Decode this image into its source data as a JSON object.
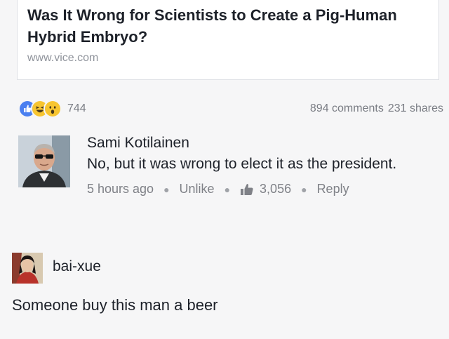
{
  "link_preview": {
    "title": "Was It Wrong for Scientists to Create a Pig-Human Hybrid Embryo?",
    "domain": "www.vice.com"
  },
  "reactions": {
    "icons": [
      "like-icon",
      "haha-icon",
      "wow-icon"
    ],
    "count": "744",
    "comments": "894 comments",
    "shares": "231 shares"
  },
  "comment": {
    "author": "Sami Kotilainen",
    "text": "No, but it was wrong to elect it as the president.",
    "time": "5 hours ago",
    "unlike_label": "Unlike",
    "like_count": "3,056",
    "reply_label": "Reply"
  },
  "reply": {
    "author": "bai-xue",
    "text": "Someone buy this man a beer"
  },
  "colors": {
    "like_blue": "#4a7ff0",
    "emoji_yellow": "#f7c531",
    "text_dark": "#1d2129",
    "text_grey": "#7f8187"
  }
}
